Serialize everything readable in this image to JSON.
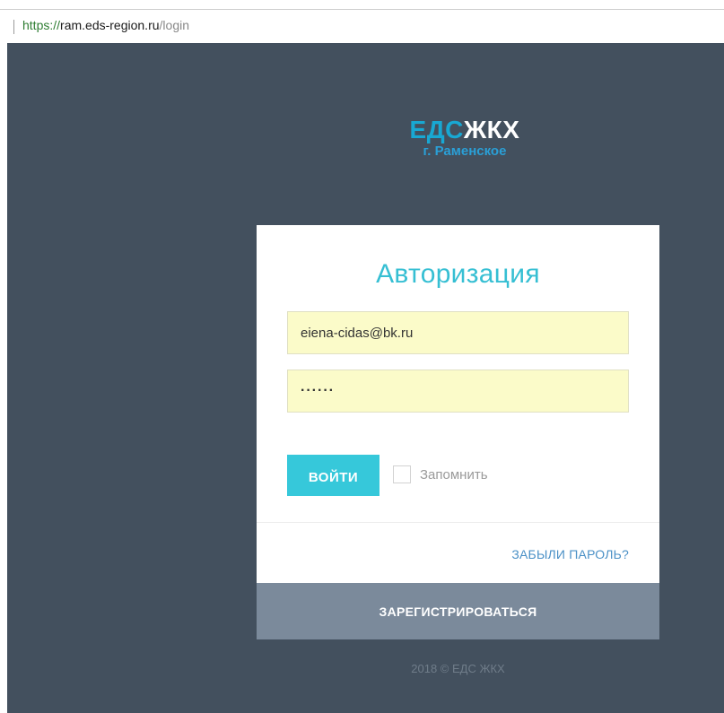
{
  "browser": {
    "url_scheme": "https://",
    "url_host": "ram.eds-region.ru",
    "url_path": "/login"
  },
  "logo": {
    "part1": "ЕДС",
    "part2": "ЖКХ",
    "subtitle": "г. Раменское"
  },
  "login_form": {
    "title": "Авторизация",
    "email_value": "eiena-cidas@bk.ru",
    "password_value": "······",
    "login_button_label": "ВОЙТИ",
    "remember_label": "Запомнить",
    "remember_checked": false,
    "forgot_password_label": "ЗАБЫЛИ ПАРОЛЬ?",
    "register_button_label": "ЗАРЕГИСТРИРОВАТЬСЯ"
  },
  "footer": {
    "copyright": "2018 © ЕДС ЖКХ"
  },
  "colors": {
    "page_background": "#43505e",
    "accent": "#36c8da",
    "logo_blue": "#18a8d3",
    "register_background": "#7b8a9b",
    "input_background": "#fbfbc9"
  }
}
